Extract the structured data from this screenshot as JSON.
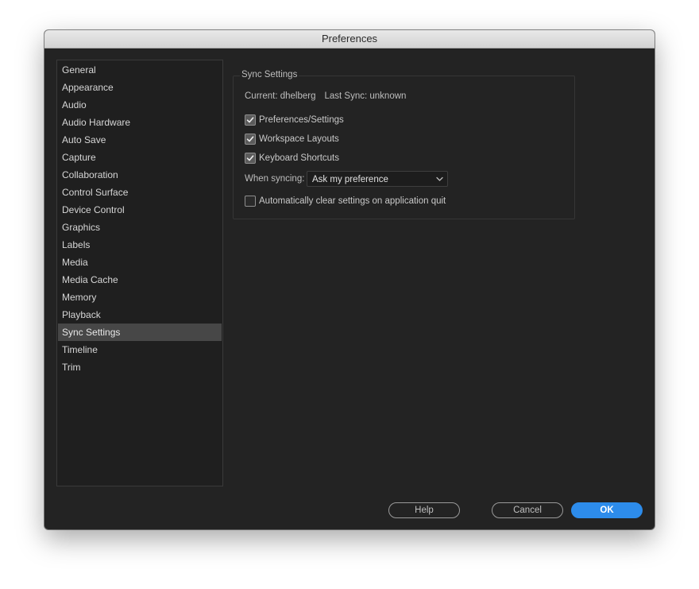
{
  "window": {
    "title": "Preferences"
  },
  "sidebar": {
    "items": [
      {
        "label": "General"
      },
      {
        "label": "Appearance"
      },
      {
        "label": "Audio"
      },
      {
        "label": "Audio Hardware"
      },
      {
        "label": "Auto Save"
      },
      {
        "label": "Capture"
      },
      {
        "label": "Collaboration"
      },
      {
        "label": "Control Surface"
      },
      {
        "label": "Device Control"
      },
      {
        "label": "Graphics"
      },
      {
        "label": "Labels"
      },
      {
        "label": "Media"
      },
      {
        "label": "Media Cache"
      },
      {
        "label": "Memory"
      },
      {
        "label": "Playback"
      },
      {
        "label": "Sync Settings",
        "selected": true
      },
      {
        "label": "Timeline"
      },
      {
        "label": "Trim"
      }
    ]
  },
  "sync": {
    "group_title": "Sync Settings",
    "current": "Current: dhelberg",
    "last_sync": "Last Sync: unknown",
    "options": [
      {
        "label": "Preferences/Settings",
        "checked": true
      },
      {
        "label": "Workspace Layouts",
        "checked": true
      },
      {
        "label": "Keyboard Shortcuts",
        "checked": true
      }
    ],
    "when_syncing_label": "When syncing:",
    "when_syncing_value": "Ask my preference",
    "auto_clear": {
      "label": "Automatically clear settings on application quit",
      "checked": false
    }
  },
  "buttons": {
    "help": "Help",
    "cancel": "Cancel",
    "ok": "OK"
  },
  "colors": {
    "accent": "#2d8ceb",
    "window_bg": "#232323",
    "selected_item": "#474747"
  },
  "icons": {
    "checkmark": "checkmark-icon",
    "dropdown": "chevron-down-icon"
  }
}
